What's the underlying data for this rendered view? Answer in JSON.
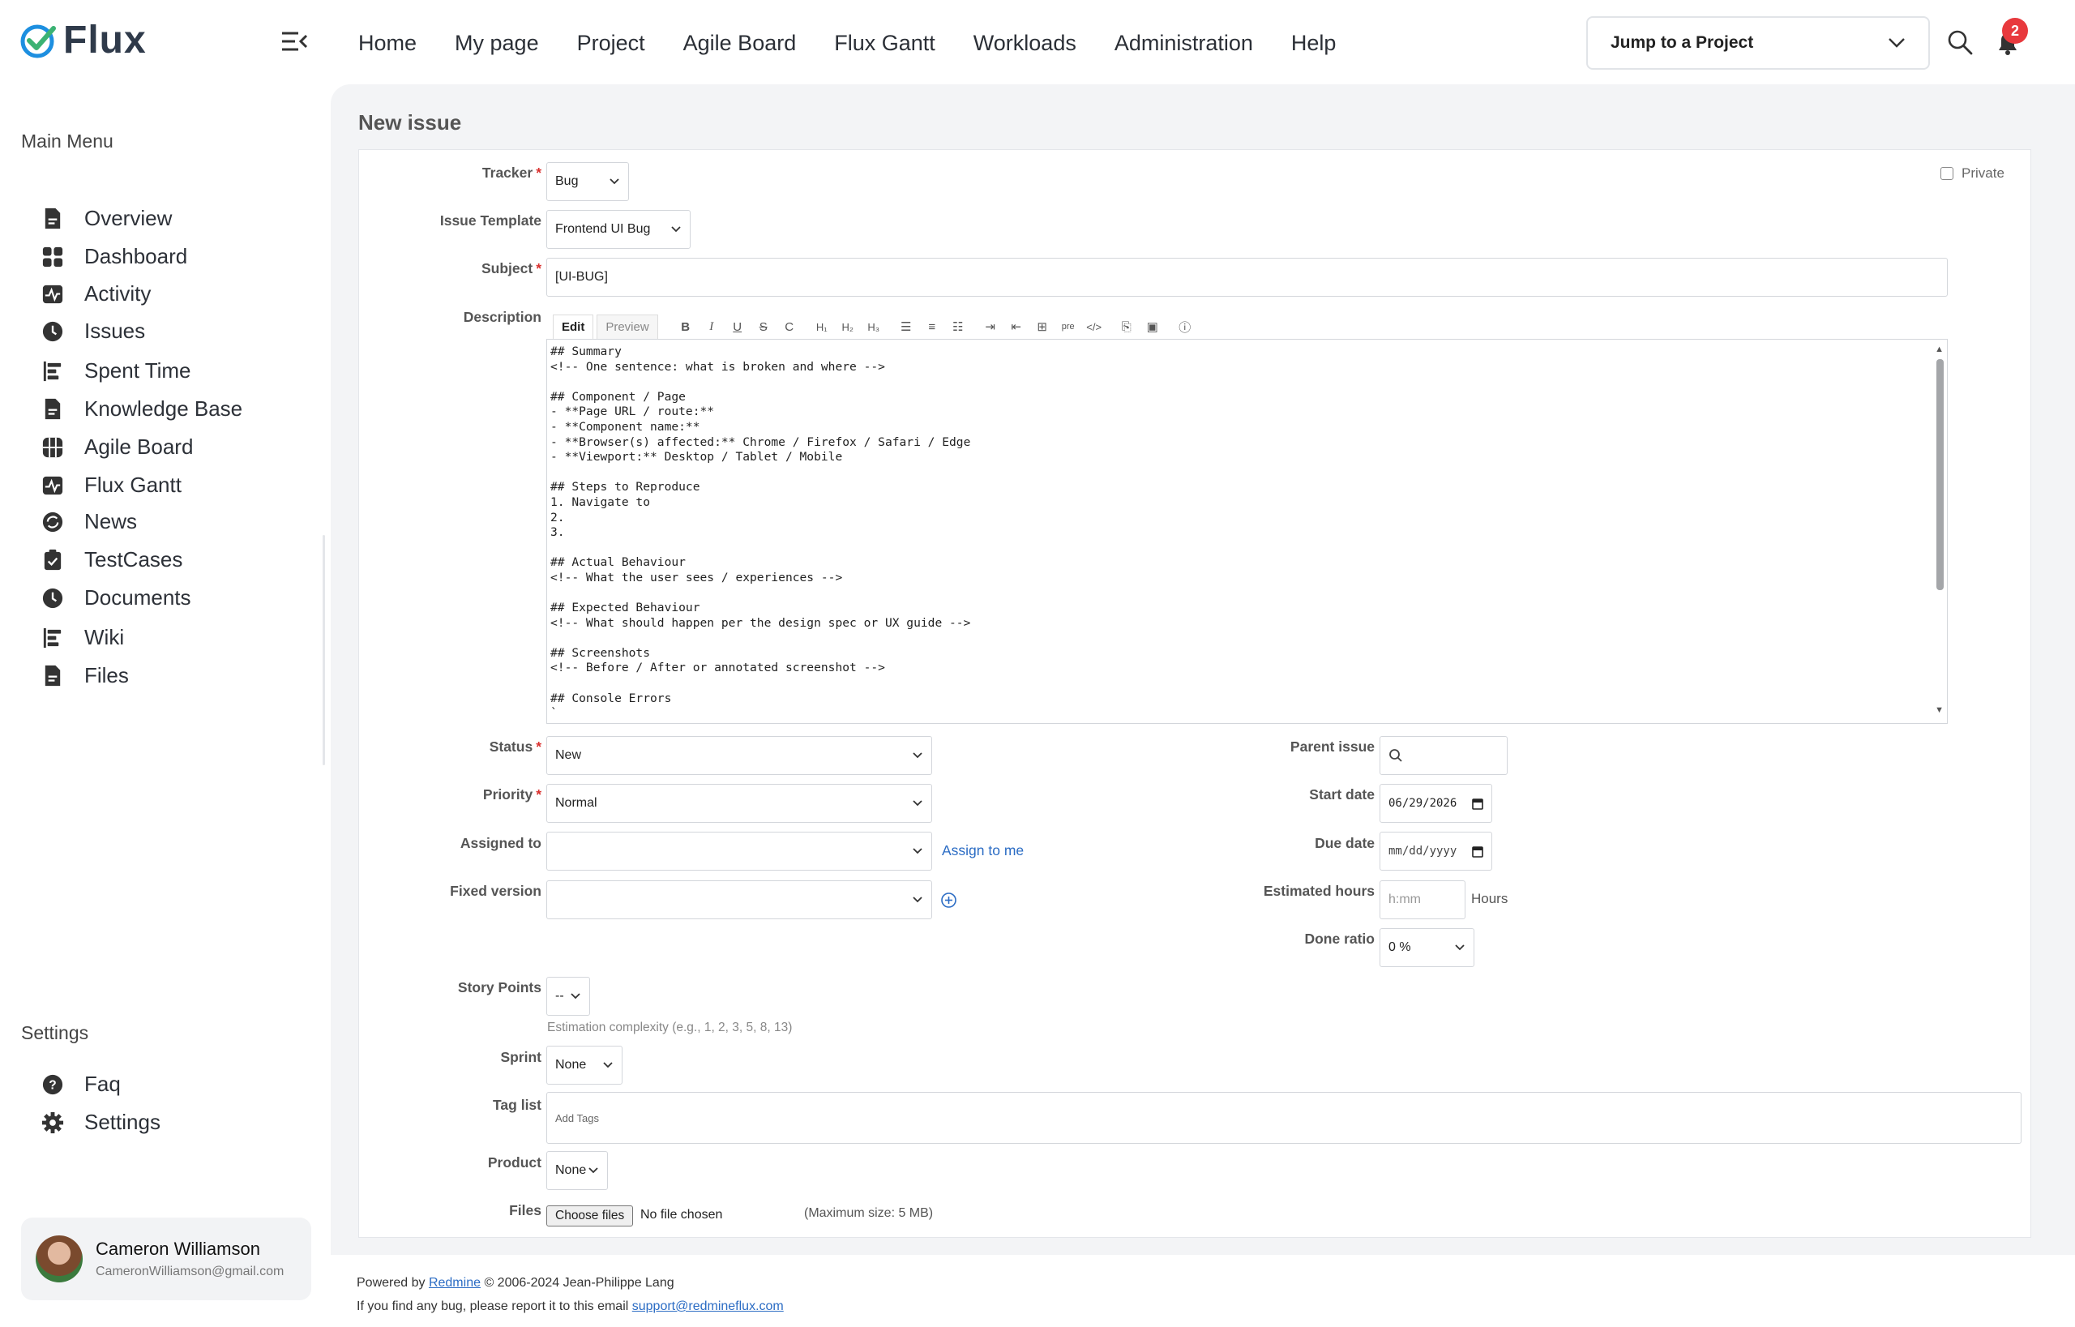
{
  "brand": {
    "name": "Flux",
    "accent": "#1d8fe0",
    "check": "#3bb273"
  },
  "topnav": [
    "Home",
    "My page",
    "Project",
    "Agile Board",
    "Flux Gantt",
    "Workloads",
    "Administration",
    "Help"
  ],
  "jump": {
    "label": "Jump to a Project"
  },
  "notifications": {
    "count": "2"
  },
  "sidebar": {
    "main_title": "Main Menu",
    "items": [
      {
        "label": "Overview",
        "icon": "document-icon"
      },
      {
        "label": "Dashboard",
        "icon": "dashboard-icon"
      },
      {
        "label": "Activity",
        "icon": "activity-icon"
      },
      {
        "label": "Issues",
        "icon": "clock-icon"
      },
      {
        "label": "Spent Time",
        "icon": "bars-icon"
      },
      {
        "label": "Knowledge Base",
        "icon": "document-icon"
      },
      {
        "label": "Agile Board",
        "icon": "grid-icon"
      },
      {
        "label": "Flux Gantt",
        "icon": "activity-icon"
      },
      {
        "label": "News",
        "icon": "refresh-icon"
      },
      {
        "label": "TestCases",
        "icon": "clipboard-icon"
      },
      {
        "label": "Documents",
        "icon": "clock-icon"
      },
      {
        "label": "Wiki",
        "icon": "bars-icon"
      },
      {
        "label": "Files",
        "icon": "document-icon"
      }
    ],
    "settings_title": "Settings",
    "settings_items": [
      {
        "label": "Faq",
        "icon": "help-icon"
      },
      {
        "label": "Settings",
        "icon": "gear-icon"
      }
    ]
  },
  "user": {
    "name": "Cameron Williamson",
    "email": "CameronWilliamson@gmail.com"
  },
  "page": {
    "title": "New issue"
  },
  "form": {
    "private_label": "Private",
    "tracker": {
      "label": "Tracker",
      "value": "Bug"
    },
    "template": {
      "label": "Issue Template",
      "value": "Frontend UI Bug"
    },
    "subject": {
      "label": "Subject",
      "value": "[UI-BUG]"
    },
    "description": {
      "label": "Description",
      "tab_edit": "Edit",
      "tab_preview": "Preview",
      "text": "## Summary\n<!-- One sentence: what is broken and where -->\n\n## Component / Page\n- **Page URL / route:**\n- **Component name:**\n- **Browser(s) affected:** Chrome / Firefox / Safari / Edge\n- **Viewport:** Desktop / Tablet / Mobile\n\n## Steps to Reproduce\n1. Navigate to\n2.\n3.\n\n## Actual Behaviour\n<!-- What the user sees / experiences -->\n\n## Expected Behaviour\n<!-- What should happen per the design spec or UX guide -->\n\n## Screenshots\n<!-- Before / After or annotated screenshot -->\n\n## Console Errors\n`"
    },
    "status": {
      "label": "Status",
      "value": "New"
    },
    "priority": {
      "label": "Priority",
      "value": "Normal"
    },
    "assigned": {
      "label": "Assigned to",
      "value": "",
      "link": "Assign to me"
    },
    "fixed_version": {
      "label": "Fixed version",
      "value": ""
    },
    "parent": {
      "label": "Parent issue"
    },
    "start_date": {
      "label": "Start date",
      "value": "06/29/2026"
    },
    "due_date": {
      "label": "Due date",
      "placeholder": "mm/dd/yyyy"
    },
    "est_hours": {
      "label": "Estimated hours",
      "placeholder": "h:mm",
      "unit": "Hours"
    },
    "done_ratio": {
      "label": "Done ratio",
      "value": "0 %"
    },
    "story_points": {
      "label": "Story Points",
      "value": "--",
      "hint": "Estimation complexity (e.g., 1, 2, 3, 5, 8, 13)"
    },
    "sprint": {
      "label": "Sprint",
      "value": "None"
    },
    "tags": {
      "label": "Tag list",
      "placeholder": "Add Tags"
    },
    "product": {
      "label": "Product",
      "value": "None"
    },
    "files": {
      "label": "Files",
      "button": "Choose files",
      "status": "No file chosen",
      "max": "(Maximum size: 5 MB)"
    }
  },
  "footer": {
    "powered_prefix": "Powered by",
    "powered_link": "Redmine",
    "powered_suffix": "© 2006-2024 Jean-Philippe Lang",
    "bug_text": "If you find any bug, please report it to this email",
    "bug_email": "support@redmineflux.com"
  }
}
